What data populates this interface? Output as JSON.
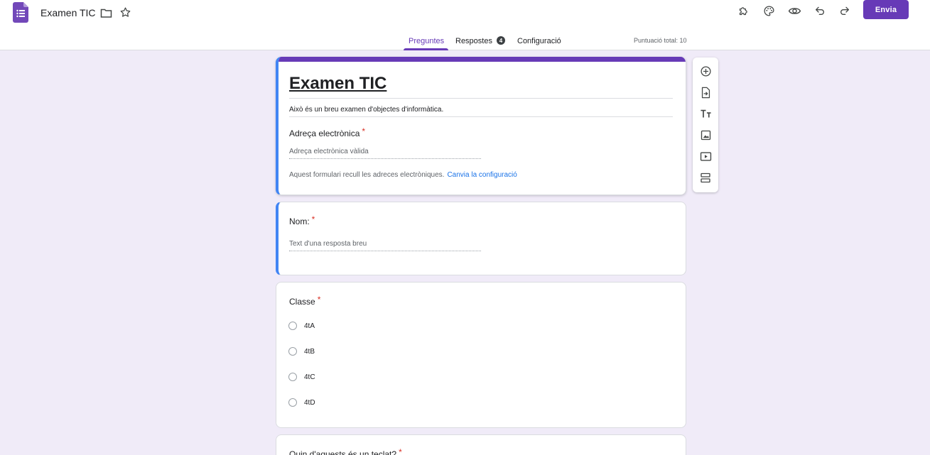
{
  "header": {
    "doc_title": "Examen TIC",
    "send_label": "Envia",
    "tabs": [
      {
        "label": "Preguntes",
        "active": true
      },
      {
        "label": "Respostes",
        "badge": "4"
      },
      {
        "label": "Configuració"
      }
    ],
    "total_score": "Puntuació total: 10",
    "icons": [
      "forms-logo-icon",
      "folder-icon",
      "star-icon",
      "addon-puzzle-icon",
      "palette-icon",
      "preview-eye-icon",
      "undo-icon",
      "redo-icon"
    ]
  },
  "form": {
    "title": "Examen TIC",
    "description": "Això és un breu examen d'objectes d'informàtica.",
    "email": {
      "label": "Adreça electrònica",
      "placeholder": "Adreça electrònica vàlida",
      "note": "Aquest formulari recull les adreces electròniques.",
      "link": "Canvia la configuració"
    },
    "required_mark": "*",
    "questions": [
      {
        "label": "Nom:",
        "placeholder": "Text d'una resposta breu"
      },
      {
        "label": "Classe",
        "options": [
          "4tA",
          "4tB",
          "4tC",
          "4tD"
        ]
      },
      {
        "label": "Quin d'aquests és un teclat?"
      }
    ]
  },
  "sidebar_tools": [
    "add-question-icon",
    "import-questions-icon",
    "add-title-icon",
    "add-image-icon",
    "add-video-icon",
    "add-section-icon"
  ],
  "colors": {
    "accent": "#673ab7",
    "focus": "#4285f4",
    "background": "#f0ebf8",
    "required": "#d93025",
    "link": "#1a73e8"
  }
}
